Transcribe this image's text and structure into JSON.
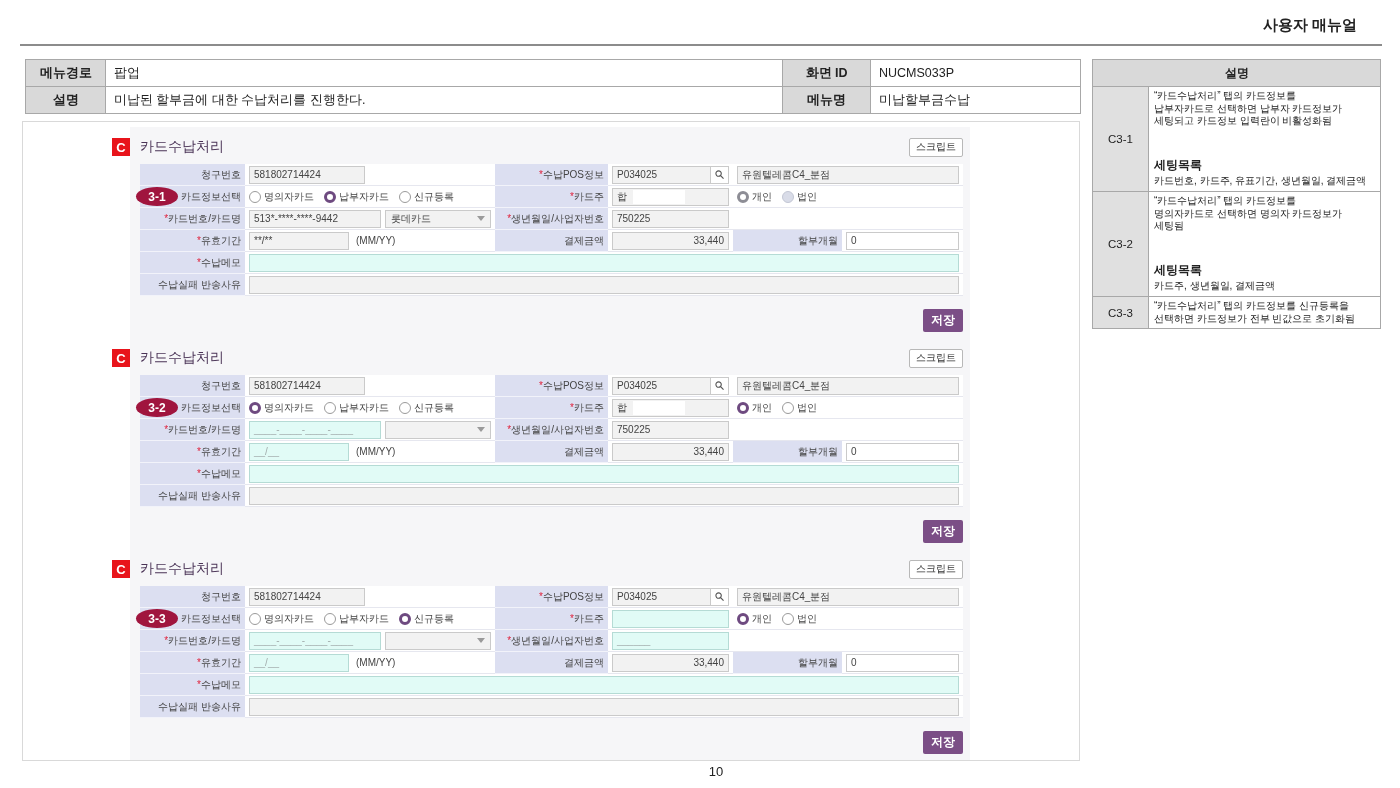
{
  "document_title": "사용자 매뉴얼",
  "info_table": {
    "rows": [
      {
        "label": "메뉴경로",
        "value": "팝업",
        "side_label": "화면 ID",
        "side_value": "NUCMS033P"
      },
      {
        "label": "설명",
        "value": "미납된 할부금에 대한 수납처리를 진행한다.",
        "side_label": "메뉴명",
        "side_value": "미납할부금수납"
      }
    ]
  },
  "panels": [
    {
      "badge": "C",
      "title": "카드수납처리",
      "script_button": "스크립트",
      "step": "3-1",
      "billing_no": {
        "label": "청구번호",
        "value": "581802714424",
        "readonly": true
      },
      "pos": {
        "required_mark": "*",
        "label": "수납POS정보",
        "code": "P034025",
        "name": "유원텔레콤C4_분점",
        "readonly": true
      },
      "card_select": {
        "label": "카드정보선택",
        "options": [
          {
            "label": "명의자카드",
            "selected": false
          },
          {
            "label": "납부자카드",
            "selected": true
          },
          {
            "label": "신규등록",
            "selected": false
          }
        ]
      },
      "card_holder": {
        "required_mark": "*",
        "label": "카드주",
        "value": "합",
        "readonly": true,
        "redacted": true
      },
      "owner_type": {
        "disabled": true,
        "options": [
          {
            "label": "개인",
            "selected": true
          },
          {
            "label": "법인",
            "selected": false
          }
        ]
      },
      "card_number": {
        "required_mark": "*",
        "label": "카드번호/카드명",
        "value": "513*-****-****-9442",
        "readonly": true
      },
      "card_company": {
        "value": "롯데카드"
      },
      "birth": {
        "required_mark": "*",
        "label": "생년월일/사업자번호",
        "value": "750225",
        "readonly": true
      },
      "expiry": {
        "required_mark": "*",
        "label": "유효기간",
        "value": "**/**",
        "readonly": true,
        "hint": "(MM/YY)"
      },
      "amount": {
        "label": "결제금액",
        "value": "33,440",
        "readonly": true
      },
      "installment": {
        "label": "할부개월",
        "value": "0",
        "readonly": false
      },
      "memo": {
        "required_mark": "*",
        "label": "수납메모",
        "readonly": false
      },
      "fail_reason": {
        "label": "수납실패 반송사유",
        "readonly": true
      },
      "save_button": "저장"
    },
    {
      "badge": "C",
      "title": "카드수납처리",
      "script_button": "스크립트",
      "step": "3-2",
      "billing_no": {
        "label": "청구번호",
        "value": "581802714424",
        "readonly": true
      },
      "pos": {
        "required_mark": "*",
        "label": "수납POS정보",
        "code": "P034025",
        "name": "유원텔레콤C4_분점",
        "readonly": true
      },
      "card_select": {
        "label": "카드정보선택",
        "options": [
          {
            "label": "명의자카드",
            "selected": true
          },
          {
            "label": "납부자카드",
            "selected": false
          },
          {
            "label": "신규등록",
            "selected": false
          }
        ]
      },
      "card_holder": {
        "required_mark": "*",
        "label": "카드주",
        "value": "합",
        "readonly": true,
        "redacted": true
      },
      "owner_type": {
        "disabled": false,
        "options": [
          {
            "label": "개인",
            "selected": true
          },
          {
            "label": "법인",
            "selected": false
          }
        ]
      },
      "card_number": {
        "required_mark": "*",
        "label": "카드번호/카드명",
        "placeholder": "____-____-____-____",
        "readonly": false
      },
      "birth": {
        "required_mark": "*",
        "label": "생년월일/사업자번호",
        "value": "750225",
        "readonly": true
      },
      "expiry": {
        "required_mark": "*",
        "label": "유효기간",
        "placeholder": "__/__",
        "readonly": false,
        "hint": "(MM/YY)"
      },
      "amount": {
        "label": "결제금액",
        "value": "33,440",
        "readonly": true
      },
      "installment": {
        "label": "할부개월",
        "value": "0",
        "readonly": false
      },
      "memo": {
        "required_mark": "*",
        "label": "수납메모",
        "readonly": false
      },
      "fail_reason": {
        "label": "수납실패 반송사유",
        "readonly": true
      },
      "save_button": "저장"
    },
    {
      "badge": "C",
      "title": "카드수납처리",
      "script_button": "스크립트",
      "step": "3-3",
      "billing_no": {
        "label": "청구번호",
        "value": "581802714424",
        "readonly": true
      },
      "pos": {
        "required_mark": "*",
        "label": "수납POS정보",
        "code": "P034025",
        "name": "유원텔레콤C4_분점",
        "readonly": true
      },
      "card_select": {
        "label": "카드정보선택",
        "options": [
          {
            "label": "명의자카드",
            "selected": false
          },
          {
            "label": "납부자카드",
            "selected": false
          },
          {
            "label": "신규등록",
            "selected": true
          }
        ]
      },
      "card_holder": {
        "required_mark": "*",
        "label": "카드주",
        "readonly": false
      },
      "owner_type": {
        "disabled": false,
        "options": [
          {
            "label": "개인",
            "selected": true
          },
          {
            "label": "법인",
            "selected": false
          }
        ]
      },
      "card_number": {
        "required_mark": "*",
        "label": "카드번호/카드명",
        "placeholder": "____-____-____-____",
        "readonly": false
      },
      "birth": {
        "required_mark": "*",
        "label": "생년월일/사업자번호",
        "placeholder": "______",
        "readonly": false
      },
      "expiry": {
        "required_mark": "*",
        "label": "유효기간",
        "placeholder": "__/__",
        "readonly": false,
        "hint": "(MM/YY)"
      },
      "amount": {
        "label": "결제금액",
        "value": "33,440",
        "readonly": true
      },
      "installment": {
        "label": "할부개월",
        "value": "0",
        "readonly": false
      },
      "memo": {
        "required_mark": "*",
        "label": "수납메모",
        "readonly": false
      },
      "fail_reason": {
        "label": "수납실패 반송사유",
        "readonly": true
      },
      "save_button": "저장"
    }
  ],
  "description_table": {
    "header": "설명",
    "rows": [
      {
        "code": "C3-1",
        "text": "“카드수납처리” 탭의 카드정보를\n납부자카드로 선택하면 납부자 카드정보가\n세팅되고 카드정보 입력란이 비활성화됨",
        "list_title": "세팅목록",
        "list_items": "카드번호, 카드주, 유표기간, 생년월일, 결제금액"
      },
      {
        "code": "C3-2",
        "text": "“카드수납처리” 탭의 카드정보를\n명의자카드로 선택하면 명의자 카드정보가\n세팅됨",
        "list_title": "세팅목록",
        "list_items": "카드주, 생년월일, 결제금액"
      },
      {
        "code": "C3-3",
        "text": "“카드수납처리” 탭의 카드정보를 신규등록을\n선택하면 카드정보가 전부 빈값으로 초기화됨"
      }
    ]
  },
  "page_number": "10"
}
